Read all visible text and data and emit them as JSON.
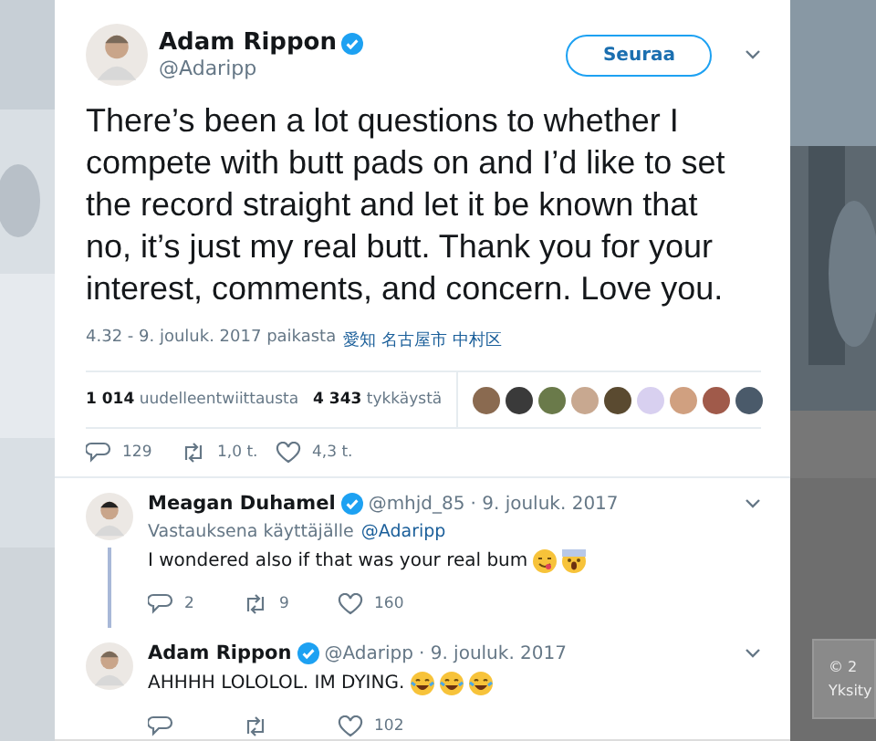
{
  "tweet": {
    "author": {
      "name": "Adam Rippon",
      "handle": "@Adaripp",
      "verified": true
    },
    "follow_button": "Seuraa",
    "text": "There’s been a lot questions to whether I compete with butt pads on and I’d like to set the record straight and let it be known that no, it’s just my real butt. Thank you for your interest, comments, and concern. Love you.",
    "timestamp": "4.32 - 9. jouluk. 2017 paikasta",
    "location": "愛知 名古屋市 中村区",
    "stats": [
      {
        "count": "1 014",
        "label": "uudelleentwiittausta"
      },
      {
        "count": "4 343",
        "label": "tykkäystä"
      }
    ],
    "likers": [
      {
        "color": "#8a6a50"
      },
      {
        "color": "#3a3a3a"
      },
      {
        "color": "#6a7a4a"
      },
      {
        "color": "#c8a890"
      },
      {
        "color": "#5a4a30"
      },
      {
        "color": "#d8d0f0"
      },
      {
        "color": "#d0a080"
      },
      {
        "color": "#a05a4a"
      },
      {
        "color": "#4a5a6a"
      }
    ],
    "actions": [
      {
        "kind": "reply",
        "count": "129"
      },
      {
        "kind": "retweet",
        "count": "1,0 t."
      },
      {
        "kind": "like",
        "count": "4,3 t."
      }
    ]
  },
  "replies": [
    {
      "name": "Meagan Duhamel",
      "verified": true,
      "handle": "@mhjd_85",
      "date": "· 9. jouluk. 2017",
      "reply_to_label": "Vastauksena käyttäjälle",
      "reply_to": "@Adaripp",
      "text": "I wondered also if that was your real bum",
      "emojis": [
        {
          "kind": "yum"
        },
        {
          "kind": "scream"
        }
      ],
      "thread_line": true,
      "actions": [
        {
          "kind": "reply",
          "count": "2"
        },
        {
          "kind": "retweet",
          "count": "9"
        },
        {
          "kind": "like",
          "count": "160"
        }
      ]
    },
    {
      "name": "Adam Rippon",
      "verified": true,
      "handle": "@Adaripp",
      "date": "· 9. jouluk. 2017",
      "text": "AHHHH LOLOLOL. IM DYING.",
      "emojis": [
        {
          "kind": "joy"
        },
        {
          "kind": "joy"
        },
        {
          "kind": "joy"
        }
      ],
      "thread_line": false,
      "actions": [
        {
          "kind": "reply"
        },
        {
          "kind": "retweet"
        },
        {
          "kind": "like",
          "count": "102"
        }
      ]
    }
  ],
  "footer": {
    "lines": [
      "© 2",
      "Yksity"
    ]
  }
}
